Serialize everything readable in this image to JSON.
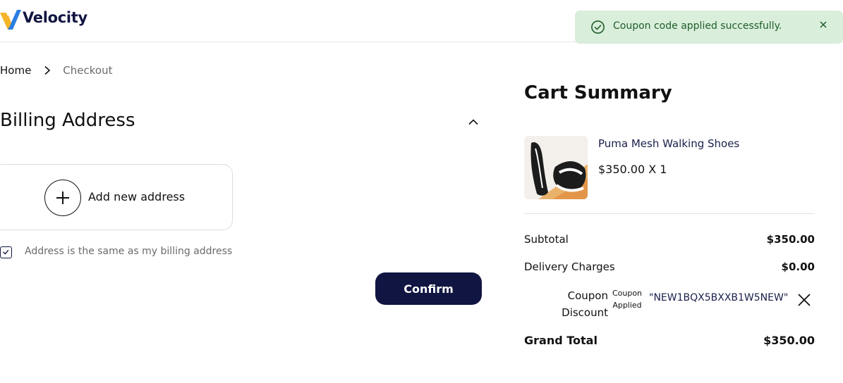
{
  "brand": {
    "name": "Velocity"
  },
  "toast": {
    "message": "Coupon code applied successfully.",
    "icon": "check-circle-icon",
    "color": "#d9eedb"
  },
  "breadcrumb": {
    "home": "Home",
    "current": "Checkout"
  },
  "billing": {
    "title": "Billing Address",
    "add_label": "Add new address",
    "same_address_label": "Address is the same as my billing address",
    "same_address_checked": true,
    "confirm_label": "Confirm"
  },
  "cart": {
    "title": "Cart Summary",
    "item": {
      "name": "Puma Mesh Walking Shoes",
      "price_qty": "$350.00 X 1"
    },
    "subtotal_label": "Subtotal",
    "subtotal_value": "$350.00",
    "delivery_label": "Delivery Charges",
    "delivery_value": "$0.00",
    "coupon_label": "Coupon Discount",
    "coupon_applied_label": "Coupon Applied",
    "coupon_code": "\"NEW1BQX5BXXB1W5NEW\"",
    "grand_total_label": "Grand Total",
    "grand_total_value": "$350.00"
  },
  "colors": {
    "primary": "#111541",
    "toast_bg": "#d9eedb",
    "toast_text": "#1f5e2a"
  }
}
